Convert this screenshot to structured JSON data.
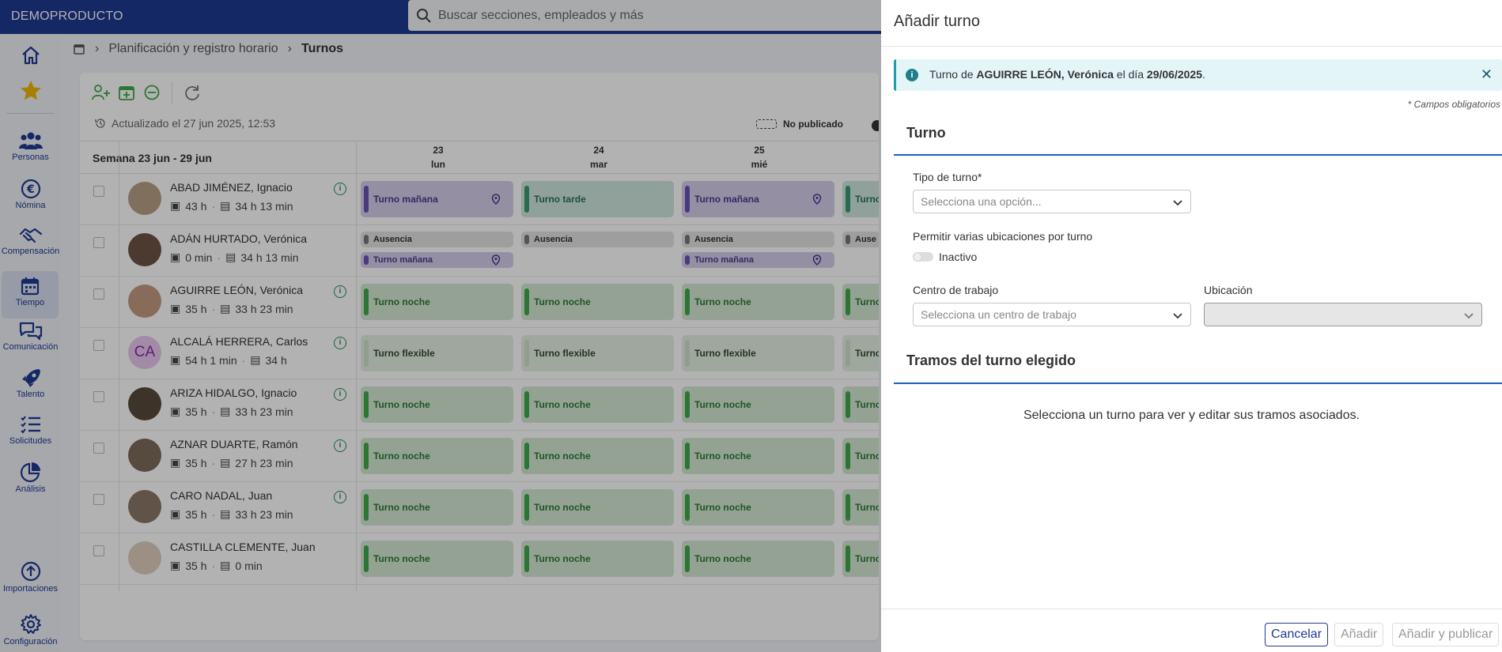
{
  "app": {
    "brand": "DEMOPRODUCTO"
  },
  "search": {
    "placeholder": "Buscar secciones, empleados y más"
  },
  "nav": {
    "items": [
      {
        "label": "Personas"
      },
      {
        "label": "Nómina"
      },
      {
        "label": "Compensación"
      },
      {
        "label": "Tiempo"
      },
      {
        "label": "Comunicación"
      },
      {
        "label": "Talento"
      },
      {
        "label": "Solicitudes"
      },
      {
        "label": "Análisis"
      },
      {
        "label": "Importaciones"
      },
      {
        "label": "Configuración"
      }
    ]
  },
  "breadcrumb": {
    "parent": "Planificación y registro horario",
    "current": "Turnos"
  },
  "schedule": {
    "updated": "Actualizado el 27 jun 2025, 12:53",
    "legend_unpublished": "No publicado",
    "week": "Semana 23 jun - 29 jun",
    "days": [
      {
        "num": "23",
        "name": "lun"
      },
      {
        "num": "24",
        "name": "mar"
      },
      {
        "num": "25",
        "name": "mié"
      }
    ],
    "employees": [
      {
        "name": "ABAD JIMÉNEZ, Ignacio",
        "planned": "43 h",
        "worked": "34 h 13 min"
      },
      {
        "name": "ADÁN HURTADO, Verónica",
        "planned": "0 min",
        "worked": "34 h 13 min"
      },
      {
        "name": "AGUIRRE LEÓN, Verónica",
        "planned": "35 h",
        "worked": "33 h 23 min"
      },
      {
        "name": "ALCALÁ HERRERA, Carlos",
        "planned": "54 h 1 min",
        "worked": "34 h",
        "initials": "CA"
      },
      {
        "name": "ARIZA HIDALGO, Ignacio",
        "planned": "35 h",
        "worked": "33 h 23 min"
      },
      {
        "name": "AZNAR DUARTE, Ramón",
        "planned": "35 h",
        "worked": "27 h 23 min"
      },
      {
        "name": "CARO NADAL, Juan",
        "planned": "35 h",
        "worked": "33 h 23 min"
      },
      {
        "name": "CASTILLA CLEMENTE, Juan",
        "planned": "35 h",
        "worked": "0 min"
      }
    ],
    "shift_labels": {
      "morning": "Turno mañana",
      "afternoon": "Turno tarde",
      "night": "Turno noche",
      "flexible": "Turno flexible",
      "absence": "Ausencia",
      "cut_turn": "Turno",
      "cut_abs": "Ause"
    }
  },
  "panel": {
    "title": "Añadir turno",
    "alert": {
      "prefix": "Turno de ",
      "employee": "AGUIRRE LEÓN, Verónica",
      "middle": " el día ",
      "date": "29/06/2025",
      "suffix": "."
    },
    "required_note": "* Campos obligatorios",
    "section_shift": "Turno",
    "shift_type_label": "Tipo de turno*",
    "shift_type_placeholder": "Selecciona una opción...",
    "multi_location_label": "Permitir varias ubicaciones por turno",
    "multi_location_state": "Inactivo",
    "workcenter_label": "Centro de trabajo",
    "workcenter_placeholder": "Selecciona un centro de trabajo",
    "location_label": "Ubicación",
    "section_segments": "Tramos del turno elegido",
    "empty_message": "Selecciona un turno para ver y editar sus tramos asociados.",
    "buttons": {
      "cancel": "Cancelar",
      "add": "Añadir",
      "add_publish": "Añadir y publicar"
    }
  },
  "colors": {
    "brand": "#1f3a93",
    "accent_line": "#1f5fbf",
    "info": "#1e9cb0"
  }
}
